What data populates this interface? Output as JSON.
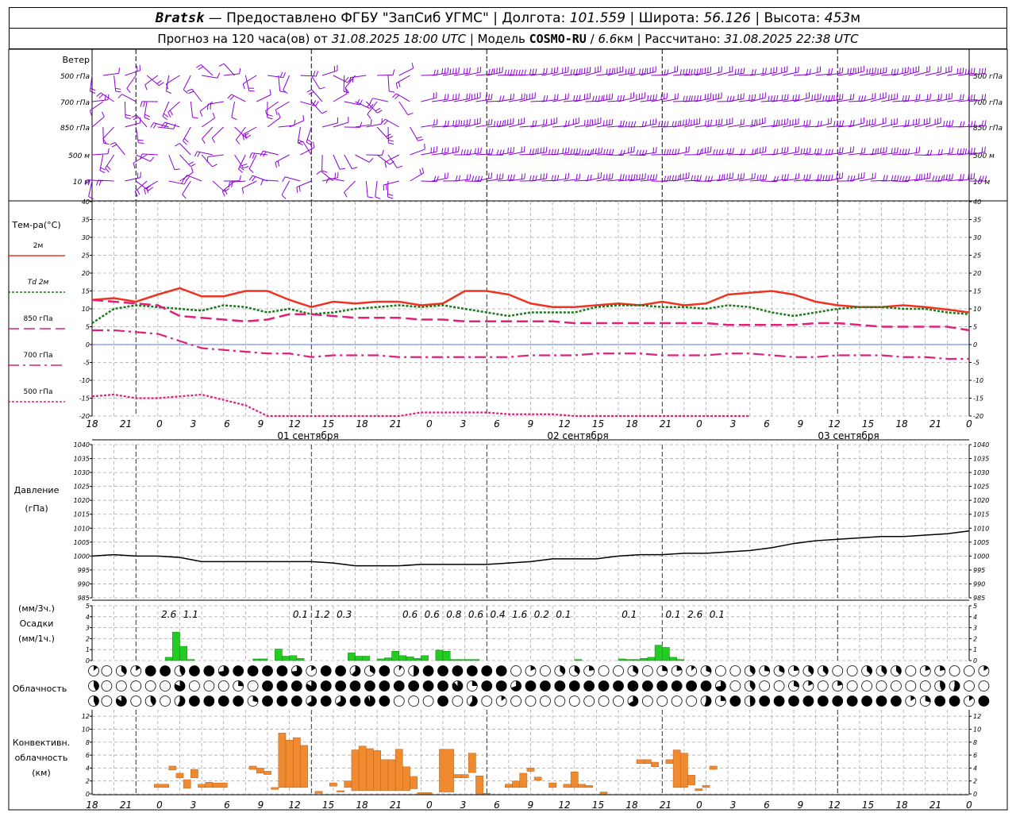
{
  "header": {
    "station": "Bratsk",
    "provider": "— Предоставлено ФГБУ \"ЗапСиб УГМС\"",
    "lon_label": "Долгота:",
    "lon": "101.559",
    "lat_label": "Широта:",
    "lat": "56.126",
    "alt_label": "Высота:",
    "alt": "453",
    "alt_unit": "м",
    "forecast_label": "Прогноз на 120 часа(ов) от",
    "forecast_time": "31.08.2025 18:00 UTC",
    "model_label": "Модель",
    "model": "COSMO-RU",
    "model_res": "6.6",
    "model_unit": "км",
    "calc_label": "Рассчитано:",
    "calc_time": "31.08.2025 22:38 UTC"
  },
  "wind": {
    "title": "Ветер",
    "levels": [
      "500 гПа",
      "700 гПа",
      "850 гПа",
      "500 м",
      "10 м"
    ],
    "color": "#8b00d8"
  },
  "temperature": {
    "title": "Тем-ра(°С)",
    "legend": [
      {
        "name": "2м",
        "color": "#ee3322"
      },
      {
        "name": "Td 2м",
        "color": "#1a7a1a"
      },
      {
        "name": "850 гПа",
        "color": "#e0207a"
      },
      {
        "name": "700 гПа",
        "color": "#e0207a"
      },
      {
        "name": "500 гПа",
        "color": "#e0207a"
      }
    ]
  },
  "pressure": {
    "title": "Давление",
    "unit": "(гПа)"
  },
  "precip": {
    "unit_top": "(мм/3ч.)",
    "title": "Осадки",
    "unit_bottom": "(мм/1ч.)"
  },
  "cloud": {
    "title": "Облачность"
  },
  "convective": {
    "title": [
      "Конвективн.",
      "облачность",
      "(км)"
    ]
  },
  "time_axis": {
    "ticks": [
      "18",
      "21",
      "0",
      "3",
      "6",
      "9",
      "12",
      "15",
      "18",
      "21",
      "0",
      "3",
      "6",
      "9",
      "12",
      "15",
      "18",
      "21",
      "0",
      "3",
      "6",
      "9",
      "12",
      "15",
      "18",
      "21",
      "0"
    ],
    "dates": [
      "01 сентября",
      "02 сентября",
      "03 сентября"
    ]
  },
  "chart_data": [
    {
      "type": "line",
      "name": "temperature",
      "x_hours": [
        0,
        3,
        6,
        9,
        12,
        15,
        18,
        21,
        24,
        27,
        30,
        33,
        36,
        39,
        42,
        45,
        48,
        51,
        54,
        57,
        60,
        63,
        66,
        69,
        72,
        75,
        78,
        81,
        84,
        87,
        90,
        93,
        96,
        99,
        102,
        105,
        108,
        111,
        114,
        117,
        120
      ],
      "ylim": [
        -20,
        40
      ],
      "yticks": [
        -20,
        -15,
        -10,
        -5,
        0,
        5,
        10,
        15,
        20,
        25,
        30,
        35,
        40
      ],
      "series": [
        {
          "name": "2м",
          "values": [
            12.5,
            13,
            12,
            14,
            15.8,
            13.5,
            13.5,
            15,
            15,
            12.5,
            10.5,
            12,
            11.5,
            12,
            12,
            11,
            11.5,
            15,
            15,
            14,
            11.5,
            10.5,
            10.5,
            11,
            11.5,
            11,
            12,
            11,
            11.5,
            14,
            14.5,
            15,
            14,
            12,
            11,
            10.5,
            10.5,
            11,
            10.5,
            9.8,
            9
          ]
        },
        {
          "name": "Td 2м",
          "values": [
            6,
            10,
            11,
            10.5,
            10,
            9.5,
            11,
            10.5,
            9,
            10,
            8.5,
            9,
            10,
            10.5,
            11,
            10.5,
            11,
            10,
            9,
            8,
            9,
            9,
            9,
            10.5,
            11,
            11,
            10.5,
            10.5,
            10,
            11,
            10.5,
            9,
            8,
            9,
            10,
            10.5,
            10.5,
            10,
            10,
            9,
            8.5
          ]
        },
        {
          "name": "850 гПа",
          "values": [
            12.5,
            12,
            11.5,
            11,
            8,
            7.5,
            7,
            6.5,
            7,
            8.5,
            8.5,
            8,
            7.5,
            7.5,
            7.5,
            7,
            7,
            6.5,
            6.5,
            6.5,
            6.5,
            6.5,
            6,
            6,
            6,
            6,
            6,
            6,
            6,
            5.5,
            5.5,
            5.5,
            5.5,
            6,
            6,
            5.5,
            5,
            5,
            5,
            5,
            4
          ]
        },
        {
          "name": "700 гПа",
          "values": [
            4,
            4,
            3.5,
            3,
            1,
            -1,
            -1.5,
            -2,
            -2.5,
            -2.5,
            -3.5,
            -3,
            -3,
            -3,
            -3.5,
            -3.5,
            -3.5,
            -3.5,
            -3.5,
            -3.5,
            -3,
            -3,
            -3,
            -2.5,
            -2.5,
            -2.5,
            -3,
            -3,
            -3,
            -2.5,
            -2.5,
            -3,
            -3.5,
            -3.5,
            -3,
            -3,
            -3,
            -3.5,
            -3.5,
            -4,
            -4
          ]
        },
        {
          "name": "500 гПа",
          "values": [
            -14.5,
            -14,
            -15,
            -15,
            -14.5,
            -14,
            -15.5,
            -17,
            -20,
            -21,
            -21,
            -22,
            -22,
            -21,
            -20,
            -19,
            -19,
            -19,
            -19,
            -19.5,
            -19.5,
            -19.5,
            -20,
            -20,
            -20.5,
            -20.5,
            -21,
            -21,
            -21,
            -20.5,
            -20,
            -20.5,
            -21,
            -21,
            -21,
            -21,
            -21,
            -21,
            -21,
            -21,
            -21
          ]
        }
      ]
    },
    {
      "type": "line",
      "name": "pressure",
      "ylim": [
        985,
        1040
      ],
      "yticks": [
        985,
        990,
        995,
        1000,
        1005,
        1010,
        1015,
        1020,
        1025,
        1030,
        1035,
        1040
      ],
      "x_hours": [
        0,
        3,
        6,
        9,
        12,
        15,
        18,
        21,
        24,
        27,
        30,
        33,
        36,
        39,
        42,
        45,
        48,
        51,
        54,
        57,
        60,
        63,
        66,
        69,
        72,
        75,
        78,
        81,
        84,
        87,
        90,
        93,
        96,
        99,
        102,
        105,
        108,
        111,
        114,
        117,
        120
      ],
      "series": [
        {
          "name": "Давление",
          "values": [
            1000,
            1000.5,
            1000,
            1000,
            999.5,
            998,
            998,
            998,
            998,
            998,
            998,
            997.5,
            996.5,
            996.5,
            996.5,
            997,
            997,
            997,
            997,
            997.5,
            998,
            999,
            999,
            999,
            1000,
            1000.5,
            1000.5,
            1001,
            1001,
            1001.5,
            1002,
            1003,
            1004.5,
            1005.5,
            1006,
            1006.5,
            1007,
            1007,
            1007.5,
            1008,
            1009
          ]
        }
      ]
    },
    {
      "type": "bar",
      "name": "precipitation",
      "unit": "mm",
      "ylim": [
        0,
        5
      ],
      "yticks": [
        0,
        1,
        2,
        3,
        4,
        5
      ],
      "labels_3h": [
        {
          "h": 10.5,
          "v": "2.6"
        },
        {
          "h": 13.5,
          "v": "1.1"
        },
        {
          "h": 28.5,
          "v": "0.1"
        },
        {
          "h": 31.5,
          "v": "1.2"
        },
        {
          "h": 34.5,
          "v": "0.3"
        },
        {
          "h": 43.5,
          "v": "0.6"
        },
        {
          "h": 46.5,
          "v": "0.6"
        },
        {
          "h": 49.5,
          "v": "0.8"
        },
        {
          "h": 52.5,
          "v": "0.6"
        },
        {
          "h": 55.5,
          "v": "0.4"
        },
        {
          "h": 58.5,
          "v": "1.6"
        },
        {
          "h": 61.5,
          "v": "0.2"
        },
        {
          "h": 64.5,
          "v": "0.1"
        },
        {
          "h": 73.5,
          "v": "0.1"
        },
        {
          "h": 79.5,
          "v": "0.1"
        },
        {
          "h": 82.5,
          "v": "2.6"
        },
        {
          "h": 85.5,
          "v": "0.1"
        }
      ],
      "bars_1h": [
        [
          10,
          0.3
        ],
        [
          11,
          2.6
        ],
        [
          12,
          1.3
        ],
        [
          13,
          0.1
        ],
        [
          22,
          0.15
        ],
        [
          23,
          0.15
        ],
        [
          25,
          1.05
        ],
        [
          26,
          0.4
        ],
        [
          27,
          0.45
        ],
        [
          28,
          0.2
        ],
        [
          35,
          0.7
        ],
        [
          36,
          0.4
        ],
        [
          37,
          0.4
        ],
        [
          39,
          0.15
        ],
        [
          40,
          0.25
        ],
        [
          41,
          0.85
        ],
        [
          42,
          0.45
        ],
        [
          43,
          0.35
        ],
        [
          44,
          0.2
        ],
        [
          45,
          0.45
        ],
        [
          47,
          0.95
        ],
        [
          48,
          0.85
        ],
        [
          49,
          0.1
        ],
        [
          50,
          0.1
        ],
        [
          51,
          0.1
        ],
        [
          52,
          0.1
        ],
        [
          66,
          0.1
        ],
        [
          72,
          0.15
        ],
        [
          73,
          0.1
        ],
        [
          74,
          0.1
        ],
        [
          75,
          0.2
        ],
        [
          76,
          0.3
        ],
        [
          77,
          1.4
        ],
        [
          78,
          1.2
        ],
        [
          79,
          0.3
        ],
        [
          80,
          0.1
        ]
      ]
    },
    {
      "type": "bar",
      "name": "convective_cloud",
      "unit": "km",
      "ylim": [
        0,
        13
      ],
      "yticks": [
        0,
        2,
        4,
        6,
        8,
        10,
        12
      ],
      "bars": [
        [
          8.5,
          10.5,
          1,
          1.5
        ],
        [
          10.5,
          11.5,
          3.7,
          4.3
        ],
        [
          11.5,
          12.5,
          2.5,
          3.2
        ],
        [
          12.5,
          13.5,
          0.9,
          2.2
        ],
        [
          13.5,
          14.5,
          2.5,
          3.8
        ],
        [
          14.5,
          15.5,
          1,
          1.5
        ],
        [
          15.5,
          16.5,
          1,
          1.8
        ],
        [
          16.5,
          18.5,
          1,
          1.7
        ],
        [
          21.5,
          22.5,
          3.8,
          4.3
        ],
        [
          22.5,
          23.5,
          3.2,
          4
        ],
        [
          23.5,
          24.5,
          3,
          3.5
        ],
        [
          24.5,
          25.5,
          0.7,
          1
        ],
        [
          25.5,
          26.5,
          1,
          9.4
        ],
        [
          26.5,
          27.5,
          1,
          8.3
        ],
        [
          27.5,
          28.5,
          1,
          8.7
        ],
        [
          28.5,
          29.5,
          1,
          7.5
        ],
        [
          30.5,
          31.5,
          0.1,
          0.4
        ],
        [
          32.5,
          33.5,
          1.2,
          1.7
        ],
        [
          33.5,
          34.5,
          0.3,
          0.5
        ],
        [
          34.5,
          35.5,
          1,
          2
        ],
        [
          35.5,
          36.5,
          0.5,
          6.8
        ],
        [
          36.5,
          37.5,
          0.5,
          7.4
        ],
        [
          37.5,
          38.5,
          0.5,
          7
        ],
        [
          38.5,
          39.5,
          0.5,
          6.7
        ],
        [
          39.5,
          40.5,
          0.5,
          5.3
        ],
        [
          40.5,
          41.5,
          0.5,
          5.3
        ],
        [
          41.5,
          42.5,
          0.5,
          6.9
        ],
        [
          42.5,
          43.5,
          0.5,
          4.2
        ],
        [
          43.5,
          44.5,
          0.8,
          2.7
        ],
        [
          44.5,
          46.5,
          0,
          0.2
        ],
        [
          47.5,
          49.5,
          0.3,
          6.9
        ],
        [
          49.5,
          50.5,
          2.5,
          3
        ],
        [
          50.5,
          51.5,
          2.5,
          3
        ],
        [
          51.5,
          52.5,
          3.3,
          6.3
        ],
        [
          52.5,
          53.5,
          0,
          2.8
        ],
        [
          53.5,
          54.5,
          0,
          0.1
        ],
        [
          56.5,
          57.5,
          1,
          1.5
        ],
        [
          57.5,
          58.5,
          1,
          2
        ],
        [
          58.5,
          59.5,
          1,
          3.2
        ],
        [
          59.5,
          60.5,
          3.5,
          4
        ],
        [
          60.5,
          61.5,
          2.1,
          2.6
        ],
        [
          62.5,
          63.5,
          1,
          1.7
        ],
        [
          64.5,
          65.5,
          1,
          1.5
        ],
        [
          65.5,
          66.5,
          1,
          3.4
        ],
        [
          66.5,
          67.5,
          1,
          1.5
        ],
        [
          67.5,
          68.5,
          1,
          1.3
        ],
        [
          69.5,
          70.5,
          0,
          0.3
        ],
        [
          74.5,
          75.5,
          4.7,
          5.3
        ],
        [
          75.5,
          76.5,
          4.7,
          5.3
        ],
        [
          76.5,
          77.5,
          4.2,
          4.9
        ],
        [
          78.5,
          79.5,
          4.7,
          5.3
        ],
        [
          79.5,
          80.5,
          1,
          6.8
        ],
        [
          80.5,
          81.5,
          1,
          6.3
        ],
        [
          81.5,
          82.5,
          1.4,
          2.9
        ],
        [
          82.5,
          83.5,
          0.5,
          0.8
        ],
        [
          83.5,
          84.5,
          1,
          1.3
        ],
        [
          84.5,
          85.5,
          3.8,
          4.3
        ]
      ]
    }
  ]
}
